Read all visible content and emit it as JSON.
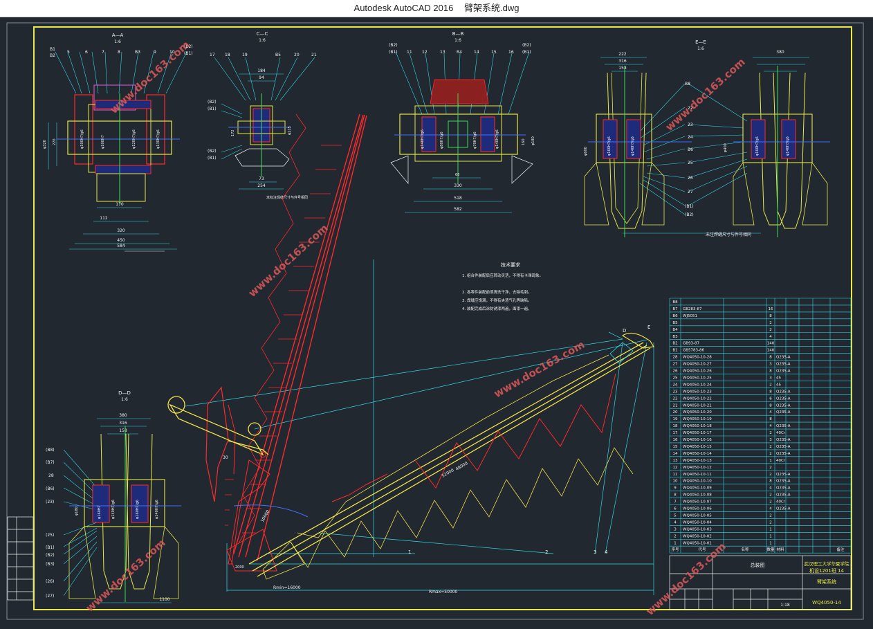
{
  "window": {
    "app_name": "Autodesk AutoCAD 2016",
    "file_name": "臂架系统.dwg"
  },
  "colors": {
    "background": "#212830",
    "frame": "#e8e84a",
    "boom": "#ff2a2a",
    "jib": "#f2e24a",
    "dim": "#33d7e6",
    "text": "#f2f2f2",
    "green": "#3ddc55",
    "magenta": "#e85cd8",
    "blue": "#4070ff",
    "watermark": "#e05a5a"
  },
  "views": {
    "aa": {
      "title": "A—A",
      "scale": "1:6"
    },
    "cc": {
      "title": "C—C",
      "scale": "1:6"
    },
    "bb": {
      "title": "B—B",
      "scale": "1:6"
    },
    "ee": {
      "title": "E—E",
      "scale": "1:6"
    },
    "dd": {
      "title": "D—D",
      "scale": "1:6"
    }
  },
  "dimensions": {
    "aa_170": "170",
    "aa_112": "112",
    "aa_320": "320",
    "aa_450": "450",
    "aa_584": "584",
    "cc_184": "184",
    "cc_94": "94",
    "cc_73": "73",
    "cc_254": "254",
    "bb_330": "330",
    "bb_518": "518",
    "bb_582": "582",
    "ee_222": "222",
    "ee_316": "316",
    "ee_158": "158",
    "ee_380": "380",
    "dd_380": "380",
    "dd_316": "316",
    "dd_158": "158",
    "dd_1100": "1100",
    "rmin": "Rmin=16000",
    "rmax": "Rmax=50000"
  },
  "tech_notes": {
    "title": "技术要求",
    "lines": [
      "1. 组合件装配后应转动灵活，不得有卡滞现象。",
      "2. 各零件装配前须清洗干净，去除毛刺。",
      "3. 焊缝应饱满，不得有夹渣气孔等缺陷。",
      "4. 装配完成后涂防锈漆两遍，面漆一遍。"
    ]
  },
  "bom": {
    "rows": [
      {
        "no": "B8",
        "code": "",
        "name": "",
        "qty": "",
        "mat": ""
      },
      {
        "no": "B7",
        "code": "GB283-87",
        "name": "",
        "qty": "16",
        "mat": ""
      },
      {
        "no": "B6",
        "code": "WJ5051",
        "name": "",
        "qty": "8",
        "mat": ""
      },
      {
        "no": "B5",
        "code": "",
        "name": "",
        "qty": "2",
        "mat": ""
      },
      {
        "no": "B4",
        "code": "",
        "name": "",
        "qty": "2",
        "mat": ""
      },
      {
        "no": "B3",
        "code": "",
        "name": "",
        "qty": "4",
        "mat": ""
      },
      {
        "no": "B2",
        "code": "GB93-87",
        "name": "",
        "qty": "140",
        "mat": ""
      },
      {
        "no": "B1",
        "code": "GB5783-86",
        "name": "",
        "qty": "140",
        "mat": ""
      },
      {
        "no": "28",
        "code": "WQ4050-10-28",
        "name": "",
        "qty": "8",
        "mat": "Q235-A"
      },
      {
        "no": "27",
        "code": "WQ4050-10-27",
        "name": "",
        "qty": "3",
        "mat": "Q235-A"
      },
      {
        "no": "26",
        "code": "WQ4050-10-26",
        "name": "",
        "qty": "8",
        "mat": "Q235-A"
      },
      {
        "no": "25",
        "code": "WQ4050-10-25",
        "name": "",
        "qty": "3",
        "mat": "45"
      },
      {
        "no": "24",
        "code": "WQ4050-10-24",
        "name": "",
        "qty": "2",
        "mat": "45"
      },
      {
        "no": "23",
        "code": "WQ4050-10-23",
        "name": "",
        "qty": "8",
        "mat": "Q235-A"
      },
      {
        "no": "22",
        "code": "WQ4050-10-22",
        "name": "",
        "qty": "6",
        "mat": "Q235-A"
      },
      {
        "no": "21",
        "code": "WQ4050-10-21",
        "name": "",
        "qty": "8",
        "mat": "Q235-A"
      },
      {
        "no": "20",
        "code": "WQ4050-10-20",
        "name": "",
        "qty": "4",
        "mat": "Q235-A"
      },
      {
        "no": "19",
        "code": "WQ4050-10-19",
        "name": "",
        "qty": "8",
        "mat": ""
      },
      {
        "no": "18",
        "code": "WQ4050-10-18",
        "name": "",
        "qty": "4",
        "mat": "Q235-A"
      },
      {
        "no": "17",
        "code": "WQ4050-10-17",
        "name": "",
        "qty": "2",
        "mat": "40Cr"
      },
      {
        "no": "16",
        "code": "WQ4050-10-16",
        "name": "",
        "qty": "3",
        "mat": "Q235-A"
      },
      {
        "no": "15",
        "code": "WQ4050-10-15",
        "name": "",
        "qty": "2",
        "mat": "Q235-A"
      },
      {
        "no": "14",
        "code": "WQ4050-10-14",
        "name": "",
        "qty": "2",
        "mat": "Q235-A"
      },
      {
        "no": "13",
        "code": "WQ4050-10-13",
        "name": "",
        "qty": "1",
        "mat": "40Cr"
      },
      {
        "no": "12",
        "code": "WQ4050-10-12",
        "name": "",
        "qty": "2",
        "mat": ""
      },
      {
        "no": "11",
        "code": "WQ4050-10-11",
        "name": "",
        "qty": "2",
        "mat": "Q235-A"
      },
      {
        "no": "10",
        "code": "WQ4050-10-10",
        "name": "",
        "qty": "8",
        "mat": "Q235-A"
      },
      {
        "no": "9",
        "code": "WQ4050-10-09",
        "name": "",
        "qty": "4",
        "mat": "Q235-A"
      },
      {
        "no": "8",
        "code": "WQ4050-10-08",
        "name": "",
        "qty": "2",
        "mat": "Q235-A"
      },
      {
        "no": "7",
        "code": "WQ4050-10-07",
        "name": "",
        "qty": "2",
        "mat": "40Cr"
      },
      {
        "no": "6",
        "code": "WQ4050-10-06",
        "name": "",
        "qty": "4",
        "mat": "Q235-A"
      },
      {
        "no": "5",
        "code": "WQ4050-10-05",
        "name": "",
        "qty": "2",
        "mat": ""
      },
      {
        "no": "4",
        "code": "WQ4050-10-04",
        "name": "",
        "qty": "2",
        "mat": ""
      },
      {
        "no": "3",
        "code": "WQ4050-10-03",
        "name": "",
        "qty": "1",
        "mat": ""
      },
      {
        "no": "2",
        "code": "WQ4050-10-02",
        "name": "",
        "qty": "1",
        "mat": ""
      },
      {
        "no": "1",
        "code": "WQ4050-10-01",
        "name": "",
        "qty": "1",
        "mat": ""
      }
    ],
    "header": {
      "no": "序号",
      "code": "代号",
      "name": "名称",
      "qty": "数量",
      "mat": "材料",
      "note": "备注"
    }
  },
  "title_block": {
    "school": "武汉理工大学华夏学院",
    "class": "机设1201班 14",
    "drawing_no": "WQ4050-14",
    "title": "臂架系统",
    "scale": "1:18",
    "weight": "",
    "assembly_label": "总装图"
  },
  "callouts": {
    "D": "D",
    "E": "E",
    "n1": "1",
    "n2": "2",
    "n3": "3",
    "n4": "4",
    "n30": "30"
  },
  "watermark": {
    "text": "www.doc163.com"
  }
}
